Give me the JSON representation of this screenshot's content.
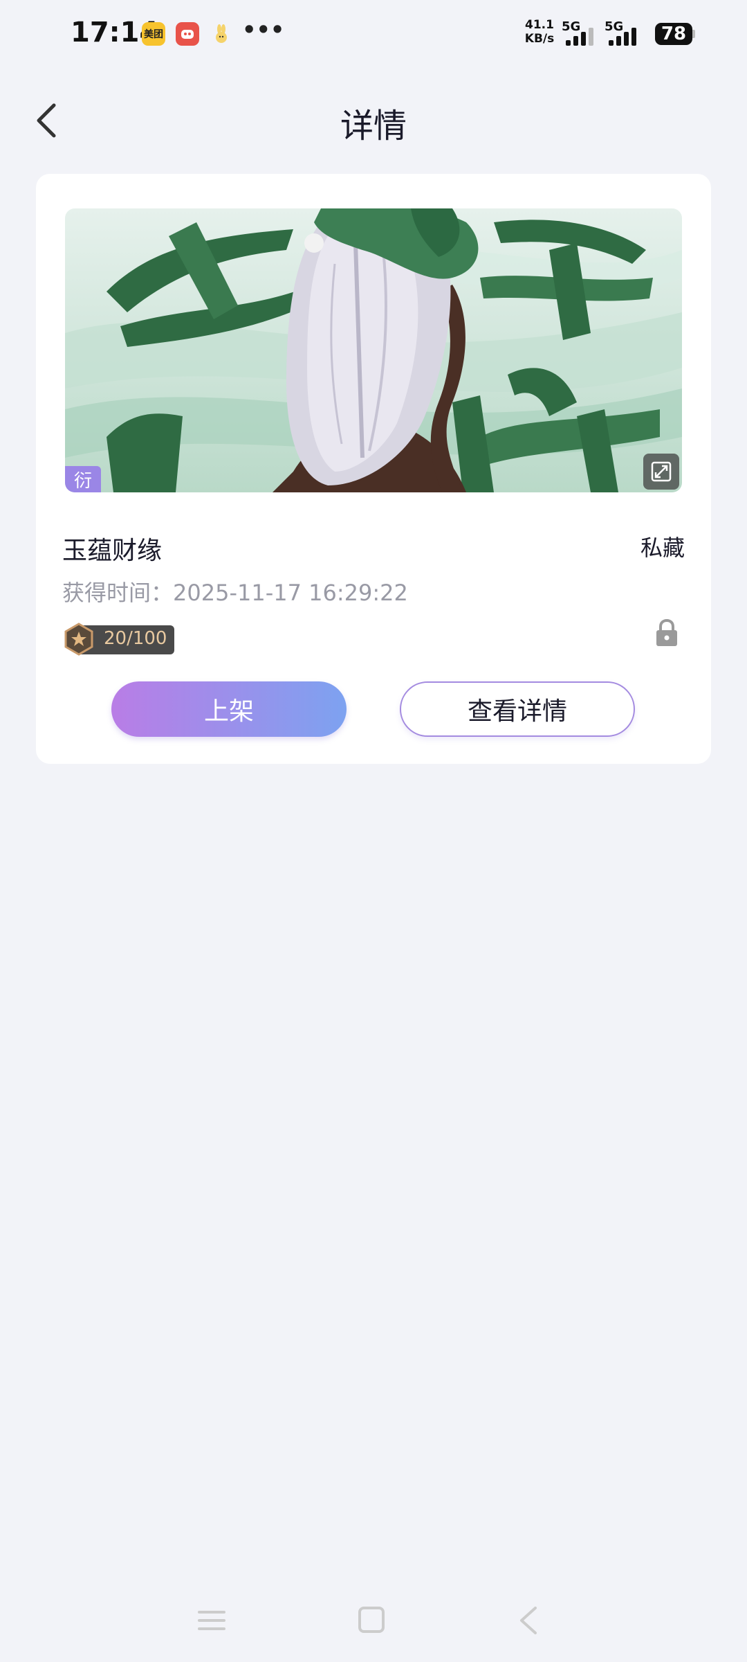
{
  "status_bar": {
    "time": "17:14",
    "app_icons": [
      "美团",
      "red-app-icon",
      "rabbit-app-icon"
    ],
    "more": "•••",
    "net_speed_value": "41.1",
    "net_speed_unit": "KB/s",
    "sim1_type": "5G",
    "sim2_type": "5G",
    "battery": "78"
  },
  "header": {
    "title": "详情"
  },
  "card": {
    "tag": "衍",
    "name": "玉蕴财缘",
    "visibility": "私藏",
    "obtain_label": "获得时间：",
    "obtain_time": "2025-11-17 16:29:22",
    "progress": "20/100",
    "list_button": "上架",
    "detail_button": "查看详情"
  },
  "colors": {
    "background": "#f2f3f8",
    "accent_gradient_start": "#b97de6",
    "accent_gradient_end": "#7da2f0",
    "tag_purple": "#9a86e6"
  }
}
